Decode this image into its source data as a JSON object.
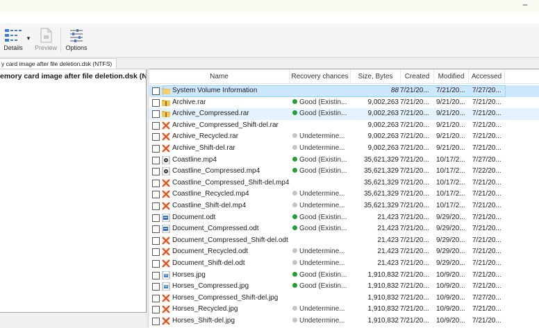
{
  "window": {
    "minimize_glyph": "–"
  },
  "toolbar": {
    "details_label": "Details",
    "details_arrow": "▾",
    "preview_label": "Preview",
    "options_label": "Options"
  },
  "tab": {
    "label": "y card image after file deletion.dsk (NTFS)"
  },
  "tree": {
    "root_label": "emory card image after file deletion.dsk (NTF"
  },
  "columns": [
    "Name",
    "Recovery chances",
    "Size, Bytes",
    "Created",
    "Modified",
    "Accessed"
  ],
  "rows": [
    {
      "name": "System Volume Information",
      "icon": "folder-icon",
      "recovery": "",
      "status": "",
      "size": "88",
      "created": "7/21/20...",
      "modified": "7/21/20...",
      "accessed": "7/27/20..."
    },
    {
      "name": "Archive.rar",
      "icon": "archive-icon",
      "recovery": "Good (Existin...",
      "status": "good",
      "size": "9,002,263",
      "created": "7/21/20...",
      "modified": "9/21/20...",
      "accessed": "7/21/20..."
    },
    {
      "name": "Archive_Compressed.rar",
      "icon": "archive-icon",
      "recovery": "Good (Existin...",
      "status": "good",
      "size": "9,002,263",
      "created": "7/21/20...",
      "modified": "9/21/20...",
      "accessed": "7/21/20..."
    },
    {
      "name": "Archive_Compressed_Shift-del.rar",
      "icon": "deleted-file-icon",
      "recovery": "",
      "status": "",
      "size": "9,002,263",
      "created": "7/21/20...",
      "modified": "9/21/20...",
      "accessed": "7/21/20..."
    },
    {
      "name": "Archive_Recycled.rar",
      "icon": "deleted-file-icon",
      "recovery": "Undetermine...",
      "status": "undetermined",
      "size": "9,002,263",
      "created": "7/21/20...",
      "modified": "9/21/20...",
      "accessed": "7/21/20..."
    },
    {
      "name": "Archive_Shift-del.rar",
      "icon": "deleted-file-icon",
      "recovery": "Undetermine...",
      "status": "undetermined",
      "size": "9,002,263",
      "created": "7/21/20...",
      "modified": "9/21/20...",
      "accessed": "7/21/20..."
    },
    {
      "name": "Coastline.mp4",
      "icon": "video-file-icon",
      "recovery": "Good (Existin...",
      "status": "good",
      "size": "35,621,329",
      "created": "7/21/20...",
      "modified": "10/17/2...",
      "accessed": "7/27/20..."
    },
    {
      "name": "Coastline_Compressed.mp4",
      "icon": "video-file-icon",
      "recovery": "Good (Existin...",
      "status": "good",
      "size": "35,621,329",
      "created": "7/21/20...",
      "modified": "10/17/2...",
      "accessed": "7/22/20..."
    },
    {
      "name": "Coastline_Compressed_Shift-del.mp4",
      "icon": "deleted-file-icon",
      "recovery": "",
      "status": "",
      "size": "35,621,329",
      "created": "7/21/20...",
      "modified": "10/17/2...",
      "accessed": "7/21/20..."
    },
    {
      "name": "Coastline_Recycled.mp4",
      "icon": "deleted-file-icon",
      "recovery": "Undetermine...",
      "status": "undetermined",
      "size": "35,621,329",
      "created": "7/21/20...",
      "modified": "10/17/2...",
      "accessed": "7/21/20..."
    },
    {
      "name": "Coastline_Shift-del.mp4",
      "icon": "deleted-file-icon",
      "recovery": "Undetermine...",
      "status": "undetermined",
      "size": "35,621,329",
      "created": "7/21/20...",
      "modified": "10/17/2...",
      "accessed": "7/21/20..."
    },
    {
      "name": "Document.odt",
      "icon": "document-file-icon",
      "recovery": "Good (Existin...",
      "status": "good",
      "size": "21,423",
      "created": "7/21/20...",
      "modified": "9/29/20...",
      "accessed": "7/21/20..."
    },
    {
      "name": "Document_Compressed.odt",
      "icon": "document-file-icon",
      "recovery": "Good (Existin...",
      "status": "good",
      "size": "21,423",
      "created": "7/21/20...",
      "modified": "9/29/20...",
      "accessed": "7/21/20..."
    },
    {
      "name": "Document_Compressed_Shift-del.odt",
      "icon": "deleted-file-icon",
      "recovery": "",
      "status": "",
      "size": "21,423",
      "created": "7/21/20...",
      "modified": "9/29/20...",
      "accessed": "7/21/20..."
    },
    {
      "name": "Document_Recycled.odt",
      "icon": "deleted-file-icon",
      "recovery": "Undetermine...",
      "status": "undetermined",
      "size": "21,423",
      "created": "7/21/20...",
      "modified": "9/29/20...",
      "accessed": "7/21/20..."
    },
    {
      "name": "Document_Shift-del.odt",
      "icon": "deleted-file-icon",
      "recovery": "Undetermine...",
      "status": "undetermined",
      "size": "21,423",
      "created": "7/21/20...",
      "modified": "9/29/20...",
      "accessed": "7/21/20..."
    },
    {
      "name": "Horses.jpg",
      "icon": "image-file-icon",
      "recovery": "Good (Existin...",
      "status": "good",
      "size": "1,910,832",
      "created": "7/21/20...",
      "modified": "10/9/20...",
      "accessed": "7/21/20..."
    },
    {
      "name": "Horses_Compressed.jpg",
      "icon": "image-file-icon",
      "recovery": "Good (Existin...",
      "status": "good",
      "size": "1,910,832",
      "created": "7/21/20...",
      "modified": "10/9/20...",
      "accessed": "7/21/20..."
    },
    {
      "name": "Horses_Compressed_Shift-del.jpg",
      "icon": "deleted-file-icon",
      "recovery": "",
      "status": "",
      "size": "1,910,832",
      "created": "7/21/20...",
      "modified": "10/9/20...",
      "accessed": "7/27/20..."
    },
    {
      "name": "Horses_Recycled.jpg",
      "icon": "deleted-file-icon",
      "recovery": "Undetermine...",
      "status": "undetermined",
      "size": "1,910,832",
      "created": "7/21/20...",
      "modified": "10/9/20...",
      "accessed": "7/21/20..."
    },
    {
      "name": "Horses_Shift-del.jpg",
      "icon": "deleted-file-icon",
      "recovery": "Undetermine...",
      "status": "undetermined",
      "size": "1,910,832",
      "created": "7/21/20...",
      "modified": "10/9/20...",
      "accessed": "7/21/20..."
    }
  ],
  "colors": {
    "selection": "#cce8ff",
    "good": "#23a030",
    "undetermined": "#c4c4c4",
    "folder": "#f2c14e",
    "deleted": "#d9531e"
  }
}
